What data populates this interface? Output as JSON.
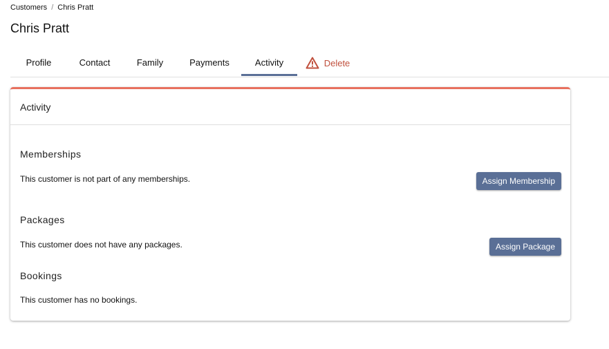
{
  "breadcrumb": {
    "items": [
      "Customers",
      "Chris Pratt"
    ],
    "separator": "/"
  },
  "page": {
    "title": "Chris Pratt"
  },
  "tabs": [
    {
      "label": "Profile",
      "active": false
    },
    {
      "label": "Contact",
      "active": false
    },
    {
      "label": "Family",
      "active": false
    },
    {
      "label": "Payments",
      "active": false
    },
    {
      "label": "Activity",
      "active": true
    },
    {
      "label": "Delete",
      "icon": "warning-triangle-icon",
      "color": "#c0503d"
    }
  ],
  "card": {
    "title": "Activity",
    "accent_color": "#e8705e",
    "sections": [
      {
        "title": "Memberships",
        "text": "This customer is not part of any memberships.",
        "button": "Assign Membership"
      },
      {
        "title": "Packages",
        "text": "This customer does not have any packages.",
        "button": "Assign Package"
      },
      {
        "title": "Bookings",
        "text": "This customer has no bookings."
      }
    ]
  },
  "colors": {
    "primary_button": "#5a6f96",
    "active_tab_underline": "#5a6f96"
  }
}
